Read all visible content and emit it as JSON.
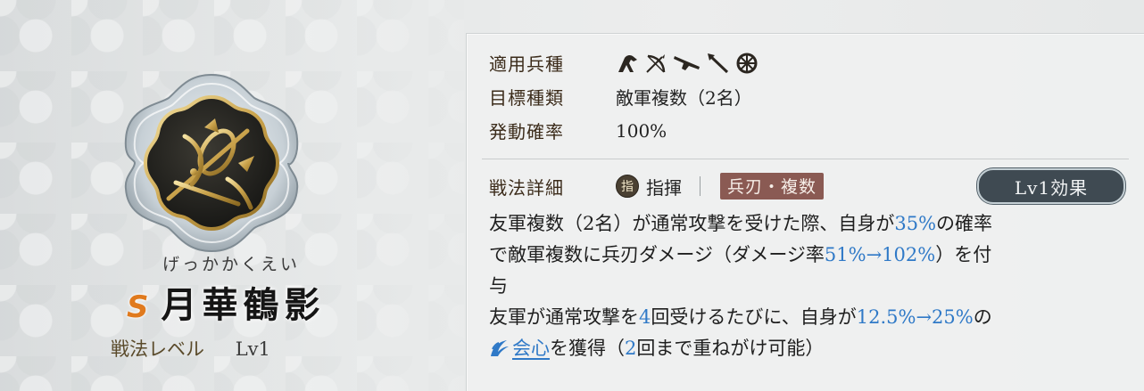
{
  "skill": {
    "kana": "げっかかくえい",
    "grade": "S",
    "name": "月華鶴影",
    "level_label": "戦法レベル",
    "level_value": "Lv1"
  },
  "attributes": {
    "troop_label": "適用兵種",
    "troop_icons": [
      "cavalry-icon",
      "bow-icon",
      "gun-icon",
      "spear-icon",
      "cart-icon"
    ],
    "target_label": "目標種類",
    "target_value": "敵軍複数（2名）",
    "rate_label": "発動確率",
    "rate_value": "100%"
  },
  "detail": {
    "label": "戦法詳細",
    "cmd_icon_char": "指",
    "type": "指揮",
    "tag": "兵刃・複数",
    "effect_button": "Lv1効果"
  },
  "description": {
    "l1a": "友軍複数（2名）が通常攻撃を受けた際、自身が",
    "l1b": "35%",
    "l1c": "の確率",
    "l2a": "で敵軍複数に兵刃ダメージ（ダメージ率",
    "l2b": "51%→102%",
    "l2c": "）を付",
    "l3": "与",
    "l4a": "友軍が通常攻撃を",
    "l4b": "4",
    "l4c": "回受けるたびに、自身が",
    "l4d": "12.5%→25%",
    "l4e": "の",
    "l5a": "会心",
    "l5b": "を獲得（",
    "l5c": "2",
    "l5d": "回まで重ねがけ可能）"
  },
  "colors": {
    "highlight": "#2f79c7",
    "grade": "#e07a1e",
    "tag_bg": "#8a5a53"
  }
}
